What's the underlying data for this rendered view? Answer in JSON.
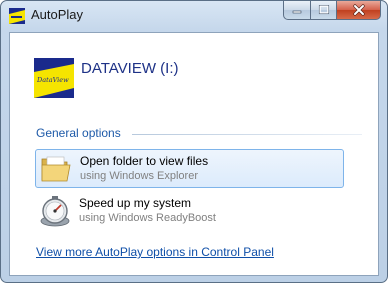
{
  "window": {
    "title": "AutoPlay",
    "minimize_icon": "minimize-icon",
    "maximize_icon": "maximize-icon",
    "close_icon": "close-icon"
  },
  "drive": {
    "label": "DATAVIEW (I:)",
    "logo_text": "DataView",
    "icon": "dataview-drive-icon"
  },
  "section": {
    "header": "General options"
  },
  "options": [
    {
      "label": "Open folder to view files",
      "sublabel": "using Windows Explorer",
      "icon": "folder-icon",
      "selected": true
    },
    {
      "label": "Speed up my system",
      "sublabel": "using Windows ReadyBoost",
      "icon": "readyboost-icon",
      "selected": false
    }
  ],
  "footer": {
    "link_text": "View more AutoPlay options in Control Panel"
  },
  "colors": {
    "titlebar": "#c5d7eb",
    "selection_border": "#7eb4ea",
    "selection_fill": "#dcebfc",
    "link": "#0f4fa8",
    "drive_title": "#1e3287",
    "section_header": "#1e5aa8",
    "logo_blue": "#1a2a8c",
    "logo_yellow": "#f5e400"
  }
}
